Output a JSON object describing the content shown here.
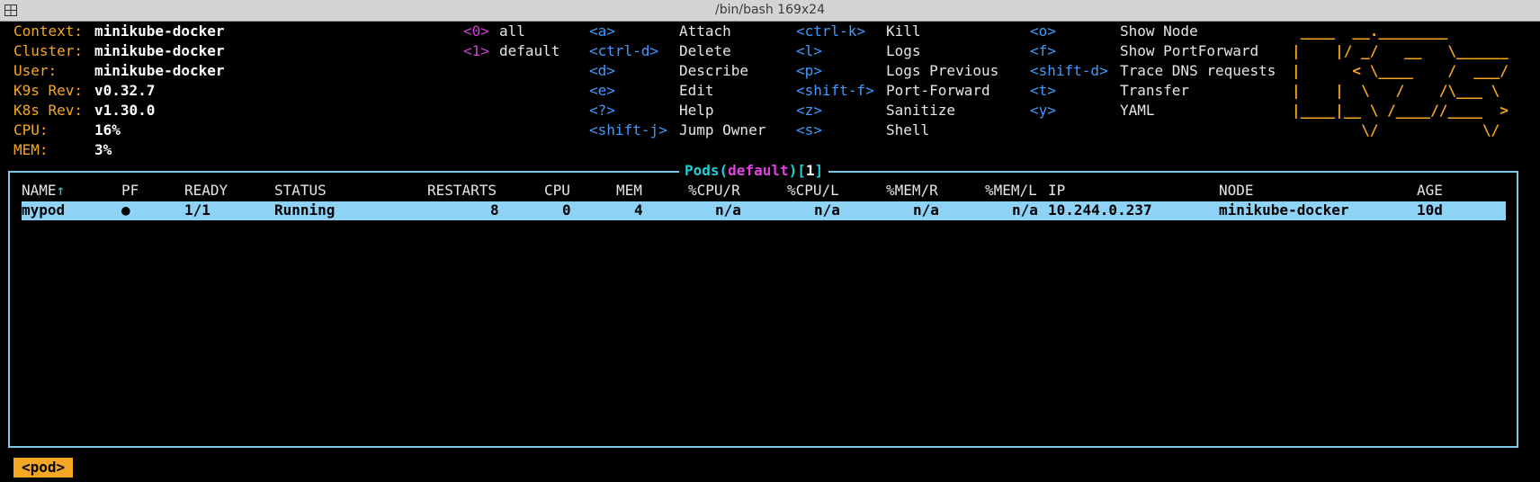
{
  "window": {
    "title": "/bin/bash 169x24"
  },
  "info": [
    {
      "label": "Context:",
      "value": "minikube-docker"
    },
    {
      "label": "Cluster:",
      "value": "minikube-docker"
    },
    {
      "label": "User:",
      "value": "minikube-docker"
    },
    {
      "label": "K9s Rev:",
      "value": "v0.32.7"
    },
    {
      "label": "K8s Rev:",
      "value": "v1.30.0"
    },
    {
      "label": "CPU:",
      "value": "16%"
    },
    {
      "label": "MEM:",
      "value": "3%"
    }
  ],
  "namespaces": [
    {
      "key": "<0>",
      "name": "all"
    },
    {
      "key": "<1>",
      "name": "default"
    }
  ],
  "shortcuts_col1": [
    {
      "key": "<a>",
      "action": "Attach"
    },
    {
      "key": "<ctrl-d>",
      "action": "Delete"
    },
    {
      "key": "<d>",
      "action": "Describe"
    },
    {
      "key": "<e>",
      "action": "Edit"
    },
    {
      "key": "<?>",
      "action": "Help"
    },
    {
      "key": "<shift-j>",
      "action": "Jump Owner"
    }
  ],
  "shortcuts_col2": [
    {
      "key": "<ctrl-k>",
      "action": "Kill"
    },
    {
      "key": "<l>",
      "action": "Logs"
    },
    {
      "key": "<p>",
      "action": "Logs Previous"
    },
    {
      "key": "<shift-f>",
      "action": "Port-Forward"
    },
    {
      "key": "<z>",
      "action": "Sanitize"
    },
    {
      "key": "<s>",
      "action": "Shell"
    }
  ],
  "shortcuts_col3": [
    {
      "key": "<o>",
      "action": "Show Node"
    },
    {
      "key": "<f>",
      "action": "Show PortForward"
    },
    {
      "key": "<shift-d>",
      "action": "Trace DNS requests"
    },
    {
      "key": "<t>",
      "action": "Transfer"
    },
    {
      "key": "<y>",
      "action": "YAML"
    }
  ],
  "logo_lines": [
    " ____  __.________",
    "|    |/ _/   __   \\______",
    "|      < \\____    /  ___/",
    "|    |  \\   /    /\\___ \\",
    "|____|__ \\ /____//____  >",
    "        \\/            \\/"
  ],
  "view": {
    "resource": "Pods",
    "open_paren": "(",
    "namespace": "default",
    "close_paren": ")",
    "open_bracket": "[",
    "count": "1",
    "close_bracket": "]"
  },
  "table": {
    "sort_arrow": "↑",
    "columns": [
      "NAME",
      "PF",
      "READY",
      "STATUS",
      "RESTARTS",
      "CPU",
      "MEM",
      "%CPU/R",
      "%CPU/L",
      "%MEM/R",
      "%MEM/L",
      "IP",
      "NODE",
      "AGE"
    ],
    "rows": [
      [
        "mypod",
        "●",
        "1/1",
        "Running",
        "8",
        "0",
        "4",
        "n/a",
        "n/a",
        "n/a",
        "n/a",
        "10.244.0.237",
        "minikube-docker",
        "10d"
      ]
    ]
  },
  "breadcrumb": {
    "label": "<pod>"
  },
  "colors": {
    "label": "#f5a623",
    "key": "#3d9bff",
    "namespace_key": "#d23fd8",
    "frame": "#7fc8ea",
    "title_cyan": "#1fd0d8",
    "row_highlight": "#8ed2f5"
  }
}
